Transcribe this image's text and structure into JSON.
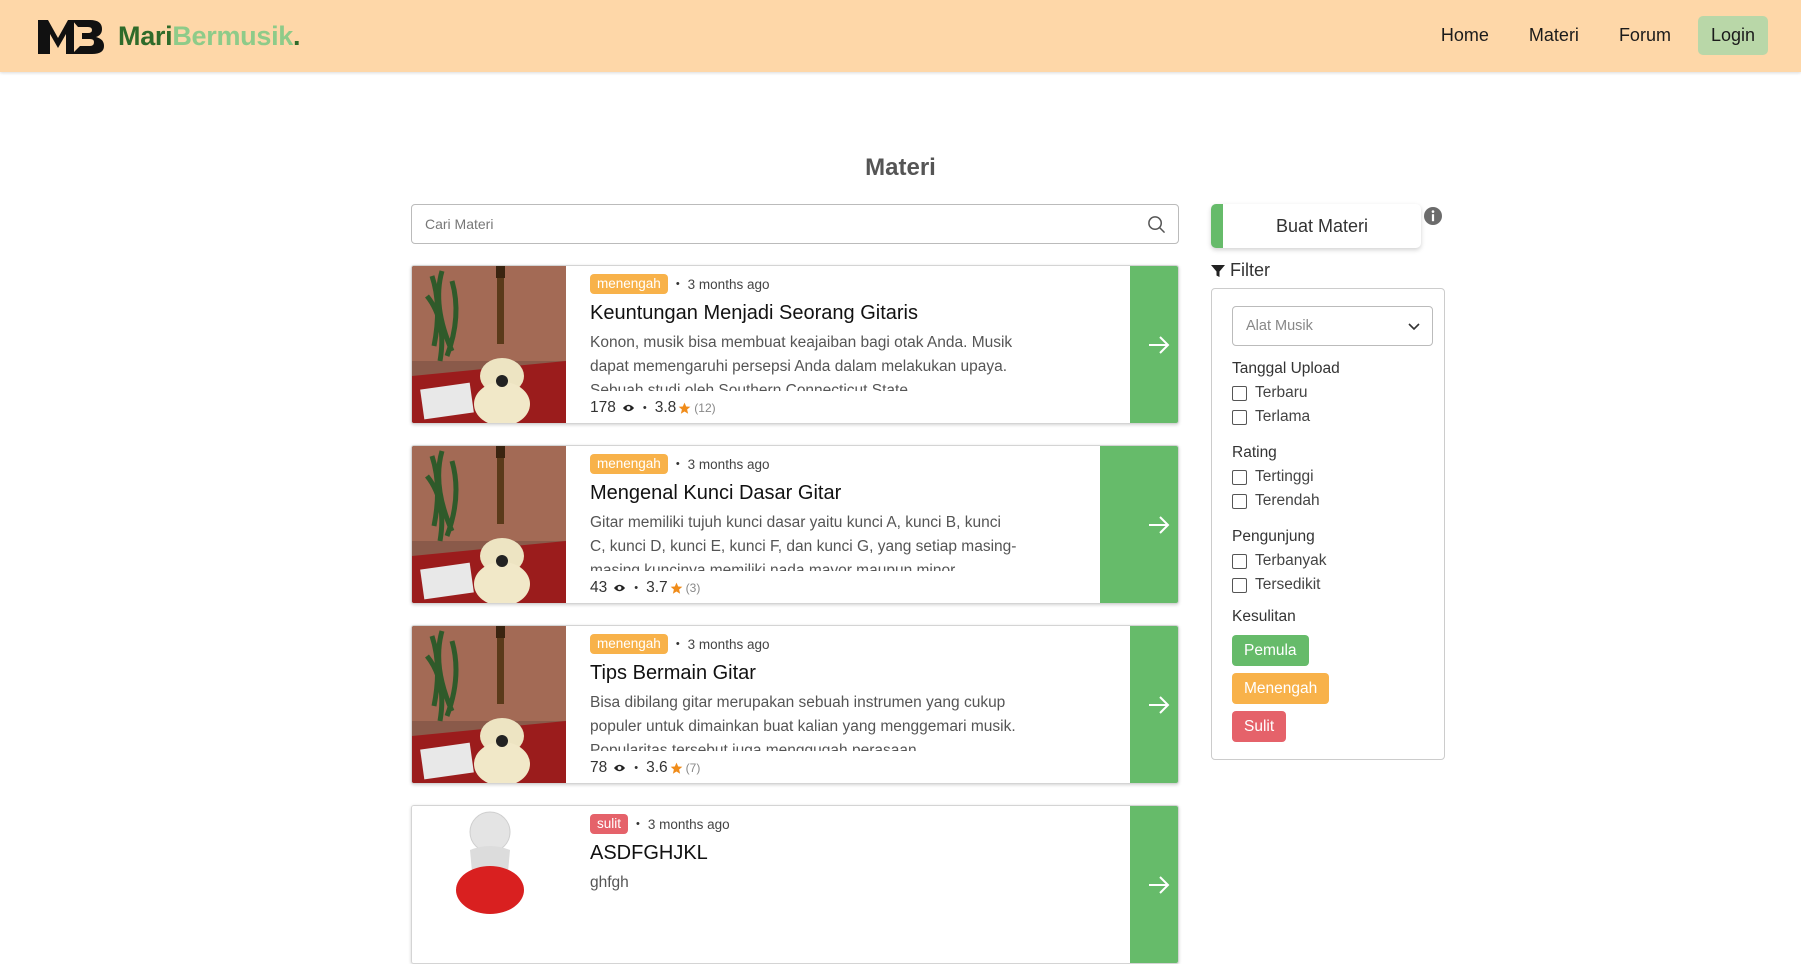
{
  "brand": {
    "part1": "Mari",
    "part2": "Bermusik",
    "dot": "."
  },
  "nav": {
    "home": "Home",
    "materi": "Materi",
    "forum": "Forum",
    "login": "Login"
  },
  "page_title": "Materi",
  "search": {
    "placeholder": "Cari Materi"
  },
  "cards": [
    {
      "level": "menengah",
      "time": "3 months ago",
      "title": "Keuntungan Menjadi Seorang Gitaris",
      "desc": "Konon, musik bisa membuat keajaiban bagi otak Anda. Musik dapat memengaruhi persepsi Anda dalam melakukan upaya. Sebuah studi oleh Southern Connecticut State",
      "views": "178",
      "rating": "3.8",
      "count": "(12)"
    },
    {
      "level": "menengah",
      "time": "3 months ago",
      "title": "Mengenal Kunci Dasar Gitar",
      "desc": "Gitar memiliki tujuh kunci dasar yaitu kunci A, kunci B, kunci C, kunci D, kunci E, kunci F, dan kunci G, yang setiap masing-masing kuncinya memiliki nada mayor maupun minor",
      "views": "43",
      "rating": "3.7",
      "count": "(3)"
    },
    {
      "level": "menengah",
      "time": "3 months ago",
      "title": "Tips Bermain Gitar",
      "desc": "Bisa dibilang gitar merupakan sebuah instrumen yang cukup populer untuk dimainkan buat kalian yang menggemari musik. Popularitas tersebut juga menggugah perasaan",
      "views": "78",
      "rating": "3.6",
      "count": "(7)"
    },
    {
      "level": "sulit",
      "time": "3 months ago",
      "title": "ASDFGHJKL",
      "desc": "ghfgh",
      "views": "",
      "rating": "",
      "count": ""
    }
  ],
  "sidebar": {
    "buat_materi": "Buat Materi",
    "filter_label": "Filter",
    "alat_musik": "Alat Musik",
    "tanggal_upload": "Tanggal Upload",
    "terbaru": "Terbaru",
    "terlama": "Terlama",
    "rating": "Rating",
    "tertinggi": "Tertinggi",
    "terendah": "Terendah",
    "pengunjung": "Pengunjung",
    "terbanyak": "Terbanyak",
    "tersedikit": "Tersedikit",
    "kesulitan": "Kesulitan",
    "pemula": "Pemula",
    "menengah": "Menengah",
    "sulit": "Sulit"
  },
  "colors": {
    "navbar": "#fed7a8",
    "green": "#66bb6a",
    "orange": "#f8b24a",
    "red": "#e5626a"
  }
}
